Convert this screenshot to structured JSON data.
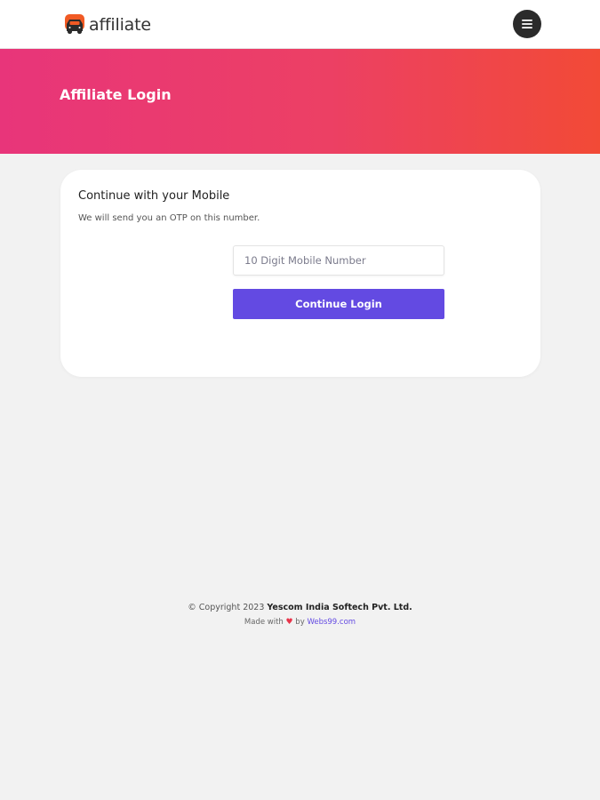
{
  "header": {
    "brand_text": "affiliate",
    "logo_icon": "car-logo-icon",
    "menu_icon": "hamburger-menu-icon"
  },
  "hero": {
    "title": "Affiliate Login"
  },
  "login_card": {
    "title": "Continue with your Mobile",
    "subtitle": "We will send you an OTP on this number.",
    "mobile_input": {
      "value": "",
      "placeholder": "10 Digit Mobile Number"
    },
    "submit_label": "Continue Login"
  },
  "footer": {
    "copyright_prefix": "© Copyright 2023",
    "company": "Yescom India Softech Pvt. Ltd.",
    "made_with": "Made with",
    "heart": "♥",
    "by": "by",
    "credit_link": "Webs99.com"
  },
  "colors": {
    "brand_accent": "#634ae2",
    "hero_gradient_start": "#e8357a",
    "hero_gradient_end": "#f24a36",
    "logo_orange": "#f15a24"
  }
}
